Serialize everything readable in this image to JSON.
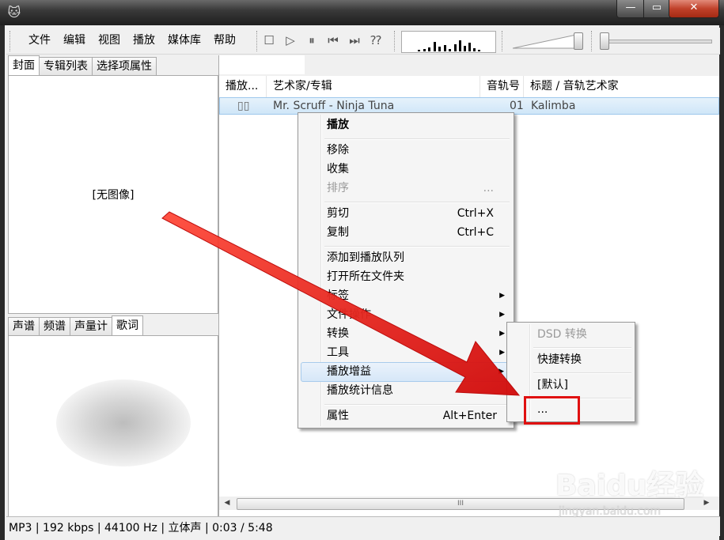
{
  "window": {
    "app_icon": "foobar-cat-icon",
    "controls": {
      "minimize": "—",
      "maximize": "▭",
      "close": "✕"
    }
  },
  "menubar": [
    "文件",
    "编辑",
    "视图",
    "播放",
    "媒体库",
    "帮助"
  ],
  "toolbar": {
    "icons": [
      "stop-icon",
      "play-icon",
      "pause-icon",
      "previous-icon",
      "next-icon",
      "random-icon"
    ],
    "glyphs": [
      "☐",
      "▷",
      "⏸",
      "⏮",
      "⏭",
      "⁇"
    ],
    "volume_level": 0.92,
    "seek_position": 0.0
  },
  "left_top_tabs": [
    "封面",
    "专辑列表",
    "选择项属性"
  ],
  "left_top_active": 0,
  "no_image_text": "[无图像]",
  "left_bottom_tabs": [
    "声谱",
    "频谱",
    "声量计",
    "歌词"
  ],
  "left_bottom_active": 3,
  "playlist": {
    "columns": [
      "播放...",
      "艺术家/专辑",
      "音轨号",
      "标题 / 音轨艺术家"
    ],
    "rows": [
      {
        "status": "▯▯",
        "artist_album": "Mr. Scruff - Ninja Tuna",
        "track": "01",
        "title": "Kalimba"
      }
    ]
  },
  "context_menu": {
    "items": [
      {
        "label": "播放",
        "bold": true
      },
      {
        "sep": true
      },
      {
        "label": "移除"
      },
      {
        "label": "收集"
      },
      {
        "label": "排序",
        "shortcut": "...",
        "disabled": true
      },
      {
        "sep": true
      },
      {
        "label": "剪切",
        "shortcut": "Ctrl+X"
      },
      {
        "label": "复制",
        "shortcut": "Ctrl+C"
      },
      {
        "sep": true
      },
      {
        "label": "添加到播放队列"
      },
      {
        "label": "打开所在文件夹"
      },
      {
        "label": "标签",
        "submenu": true
      },
      {
        "label": "文件操作",
        "submenu": true
      },
      {
        "label": "转换",
        "submenu": true
      },
      {
        "label": "工具",
        "submenu": true
      },
      {
        "label": "播放增益",
        "submenu": true,
        "highlighted": true
      },
      {
        "label": "播放统计信息"
      },
      {
        "sep": true
      },
      {
        "label": "属性",
        "shortcut": "Alt+Enter"
      }
    ]
  },
  "submenu": {
    "items": [
      {
        "label": "DSD 转换",
        "disabled": true
      },
      {
        "sep": true
      },
      {
        "label": "快捷转换"
      },
      {
        "sep": true
      },
      {
        "label": "[默认]"
      },
      {
        "sep": true
      },
      {
        "label": "..."
      }
    ]
  },
  "statusbar": {
    "text": "MP3 | 192 kbps | 44100 Hz | 立体声 | 0:03 / 5:48"
  },
  "watermark": {
    "main": "Baidu经验",
    "sub": "jingyan.baidu.com"
  },
  "colors": {
    "annotation_red": "#e01010",
    "selection_blue": "#cfe6f8"
  }
}
